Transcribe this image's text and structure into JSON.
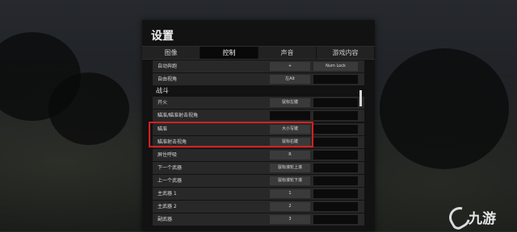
{
  "dialog": {
    "title": "设置"
  },
  "tabs": [
    {
      "label": "图像",
      "active": false
    },
    {
      "label": "控制",
      "active": true
    },
    {
      "label": "声音",
      "active": false
    },
    {
      "label": "游戏内容",
      "active": false
    }
  ],
  "top_rows": [
    {
      "label": "自动奔跑",
      "primary": "+",
      "secondary": "Num Lock"
    },
    {
      "label": "自由视角",
      "primary": "左Alt",
      "secondary": ""
    }
  ],
  "section_combat": {
    "title": "战斗"
  },
  "combat_rows": [
    {
      "label": "开火",
      "primary": "鼠标左键",
      "secondary": ""
    },
    {
      "label": "瞄准/瞄准射击视角",
      "primary": "",
      "secondary": ""
    },
    {
      "label": "瞄准",
      "primary": "大小写键",
      "secondary": ""
    },
    {
      "label": "瞄准射击视角",
      "primary": "鼠标右键",
      "secondary": ""
    },
    {
      "label": "屏住呼吸",
      "primary": "R",
      "secondary": ""
    },
    {
      "label": "下一个武器",
      "primary": "鼠标滚轮上滚",
      "secondary": ""
    },
    {
      "label": "上一个武器",
      "primary": "鼠标滚轮下滚",
      "secondary": ""
    },
    {
      "label": "主武器 1",
      "primary": "1",
      "secondary": ""
    },
    {
      "label": "主武器 2",
      "primary": "2",
      "secondary": ""
    },
    {
      "label": "副武器",
      "primary": "3",
      "secondary": ""
    }
  ],
  "watermark": {
    "text": "九游"
  },
  "colors": {
    "highlight": "#d62020",
    "panel": "#121212",
    "row": "#282828"
  }
}
